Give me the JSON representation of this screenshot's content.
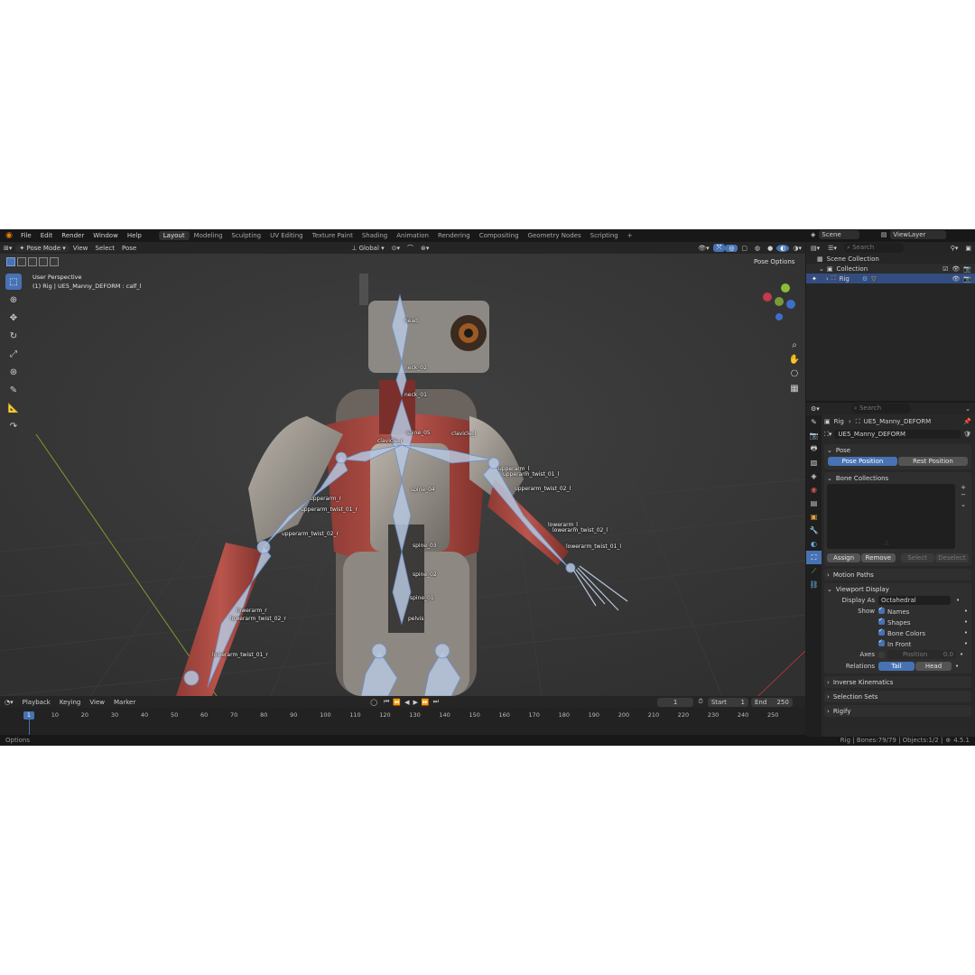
{
  "menubar": {
    "menus": [
      "File",
      "Edit",
      "Render",
      "Window",
      "Help"
    ],
    "workspaces": [
      "Layout",
      "Modeling",
      "Sculpting",
      "UV Editing",
      "Texture Paint",
      "Shading",
      "Animation",
      "Rendering",
      "Compositing",
      "Geometry Nodes",
      "Scripting"
    ],
    "active_workspace": "Layout",
    "scene": "Scene",
    "view_layer": "ViewLayer"
  },
  "viewport_header": {
    "mode": "Pose Mode",
    "menus": [
      "View",
      "Select",
      "Pose"
    ],
    "transform_orientation": "Global",
    "pose_options": "Pose Options"
  },
  "viewport": {
    "perspective_label": "User Perspective",
    "object_label": "(1) Rig | UE5_Manny_DEFORM : calf_l",
    "bones": [
      {
        "name": "head"
      },
      {
        "name": "neck_02"
      },
      {
        "name": "neck_01"
      },
      {
        "name": "spine_05"
      },
      {
        "name": "clavicle_r"
      },
      {
        "name": "clavicle_l"
      },
      {
        "name": "spine_04"
      },
      {
        "name": "upperarm_l"
      },
      {
        "name": "upperarm_twist_01_l"
      },
      {
        "name": "upperarm_twist_02_l"
      },
      {
        "name": "upperarm_r"
      },
      {
        "name": "upperarm_twist_01_r"
      },
      {
        "name": "upperarm_twist_02_r"
      },
      {
        "name": "spine_03"
      },
      {
        "name": "spine_02"
      },
      {
        "name": "spine_01"
      },
      {
        "name": "pelvis"
      },
      {
        "name": "lowerarm_r"
      },
      {
        "name": "lowerarm_twist_02_r"
      },
      {
        "name": "lowerarm_twist_01_r"
      },
      {
        "name": "lowerarm_l"
      },
      {
        "name": "lowerarm_twist_02_l"
      },
      {
        "name": "lowerarm_twist_01_l"
      }
    ]
  },
  "timeline": {
    "menus": [
      "Playback",
      "Keying",
      "View",
      "Marker"
    ],
    "current_frame": "1",
    "start_label": "Start",
    "start": "1",
    "end_label": "End",
    "end": "250",
    "ticks": [
      "1",
      "10",
      "20",
      "30",
      "40",
      "50",
      "60",
      "70",
      "80",
      "90",
      "100",
      "110",
      "120",
      "130",
      "140",
      "150",
      "160",
      "170",
      "180",
      "190",
      "200",
      "210",
      "220",
      "230",
      "240",
      "250"
    ]
  },
  "outliner": {
    "search_placeholder": "Search",
    "scene_collection": "Scene Collection",
    "collection": "Collection",
    "rig": "Rig"
  },
  "properties": {
    "search_placeholder": "Search",
    "breadcrumb_object": "Rig",
    "breadcrumb_armature": "UE5_Manny_DEFORM",
    "datablock": "UE5_Manny_DEFORM",
    "pose_section": "Pose",
    "pose_position": "Pose Position",
    "rest_position": "Rest Position",
    "bone_collections": "Bone Collections",
    "assign": "Assign",
    "remove": "Remove",
    "select": "Select",
    "deselect": "Deselect",
    "motion_paths": "Motion Paths",
    "viewport_display": "Viewport Display",
    "display_as_label": "Display As",
    "display_as": "Octahedral",
    "show_label": "Show",
    "show_names": "Names",
    "show_shapes": "Shapes",
    "show_bone_colors": "Bone Colors",
    "show_in_front": "In Front",
    "axes_label": "Axes",
    "axes_position": "Position",
    "axes_value": "0.0",
    "relations_label": "Relations",
    "relations_tail": "Tail",
    "relations_head": "Head",
    "inverse_kinematics": "Inverse Kinematics",
    "selection_sets": "Selection Sets",
    "rigify": "Rigify"
  },
  "statusbar": {
    "left": "Options",
    "right": "Rig | Bones:79/79 | Objects:1/2 |",
    "version": "4.5.1"
  },
  "colors": {
    "accent": "#4772b3",
    "bone": "#b7c7de",
    "selection": "#334d80"
  }
}
